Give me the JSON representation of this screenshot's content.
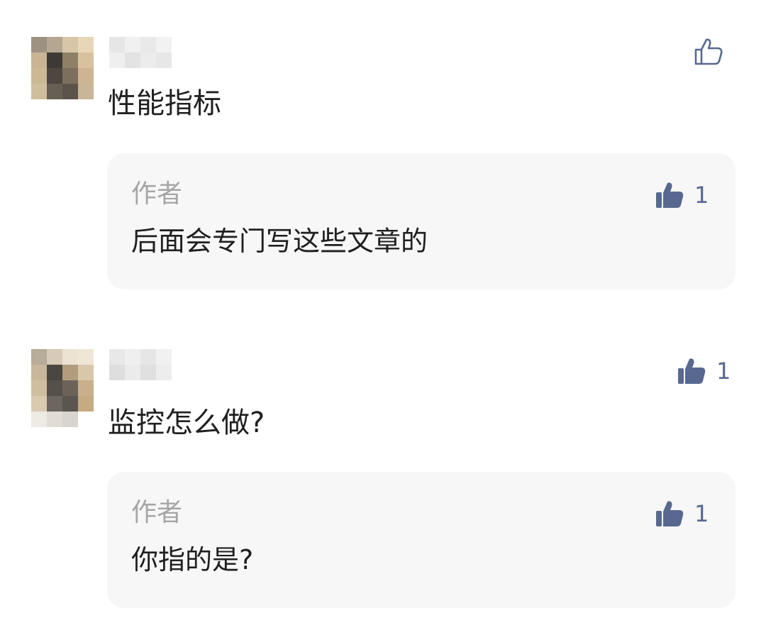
{
  "colors": {
    "like_accent": "#58688f",
    "reply_bg": "#f7f7f7",
    "author_label": "#a6a6a6",
    "text": "#1f1f1f"
  },
  "comments": [
    {
      "text": "性能指标",
      "like_icon": "thumbs-up-outline-icon",
      "like_count": "",
      "reply": {
        "author": "作者",
        "text": "后面会专门写这些文章的",
        "like_icon": "thumbs-up-filled-icon",
        "like_count": "1"
      }
    },
    {
      "text": "监控怎么做?",
      "like_icon": "thumbs-up-filled-icon",
      "like_count": "1",
      "reply": {
        "author": "作者",
        "text": "你指的是?",
        "like_icon": "thumbs-up-filled-icon",
        "like_count": "1"
      }
    }
  ]
}
